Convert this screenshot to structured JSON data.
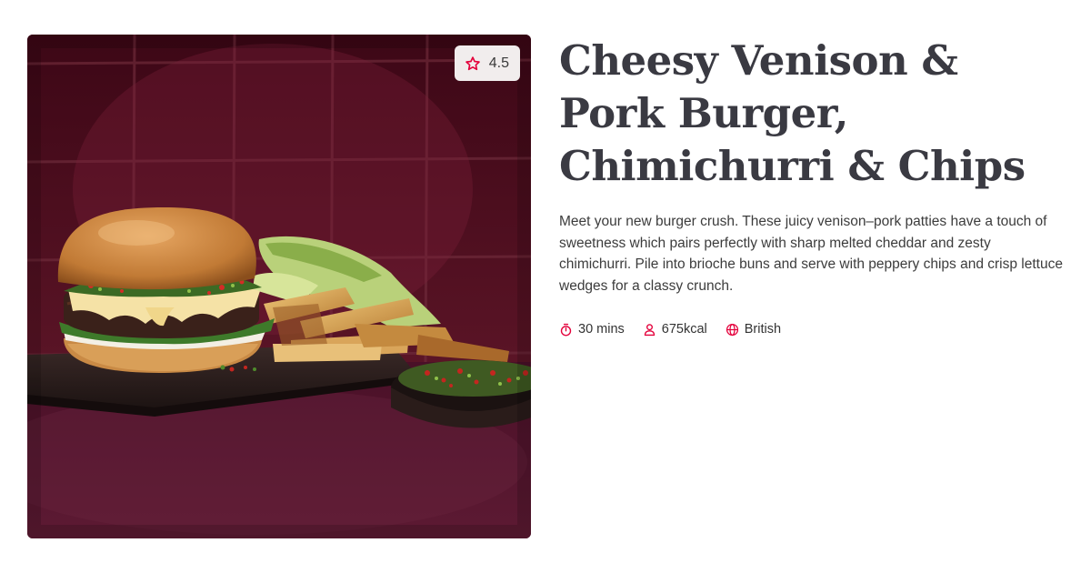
{
  "recipe": {
    "title": "Cheesy Venison & Pork Burger, Chimichurri & Chips",
    "description": "Meet your new burger crush. These juicy venison–pork patties have a touch of sweetness which pairs perfectly with sharp melted cheddar and zesty chimichurri. Pile into brioche buns and serve with peppery chips and crisp lettuce wedges for a classy crunch.",
    "rating": "4.5",
    "image": {
      "subject": "burger-with-chips-and-chimichurri"
    },
    "meta": {
      "time": "30 mins",
      "calories": "675kcal",
      "cuisine": "British"
    }
  },
  "icons": {
    "rating": "star-icon",
    "time": "timer-icon",
    "calories": "person-icon",
    "cuisine": "globe-icon"
  },
  "colors": {
    "accent": "#e4003b",
    "title": "#3a3a42",
    "body_text": "#3c3c3c",
    "badge_bg": "#f1eded",
    "photo_backdrop": "#4a0d1e"
  }
}
